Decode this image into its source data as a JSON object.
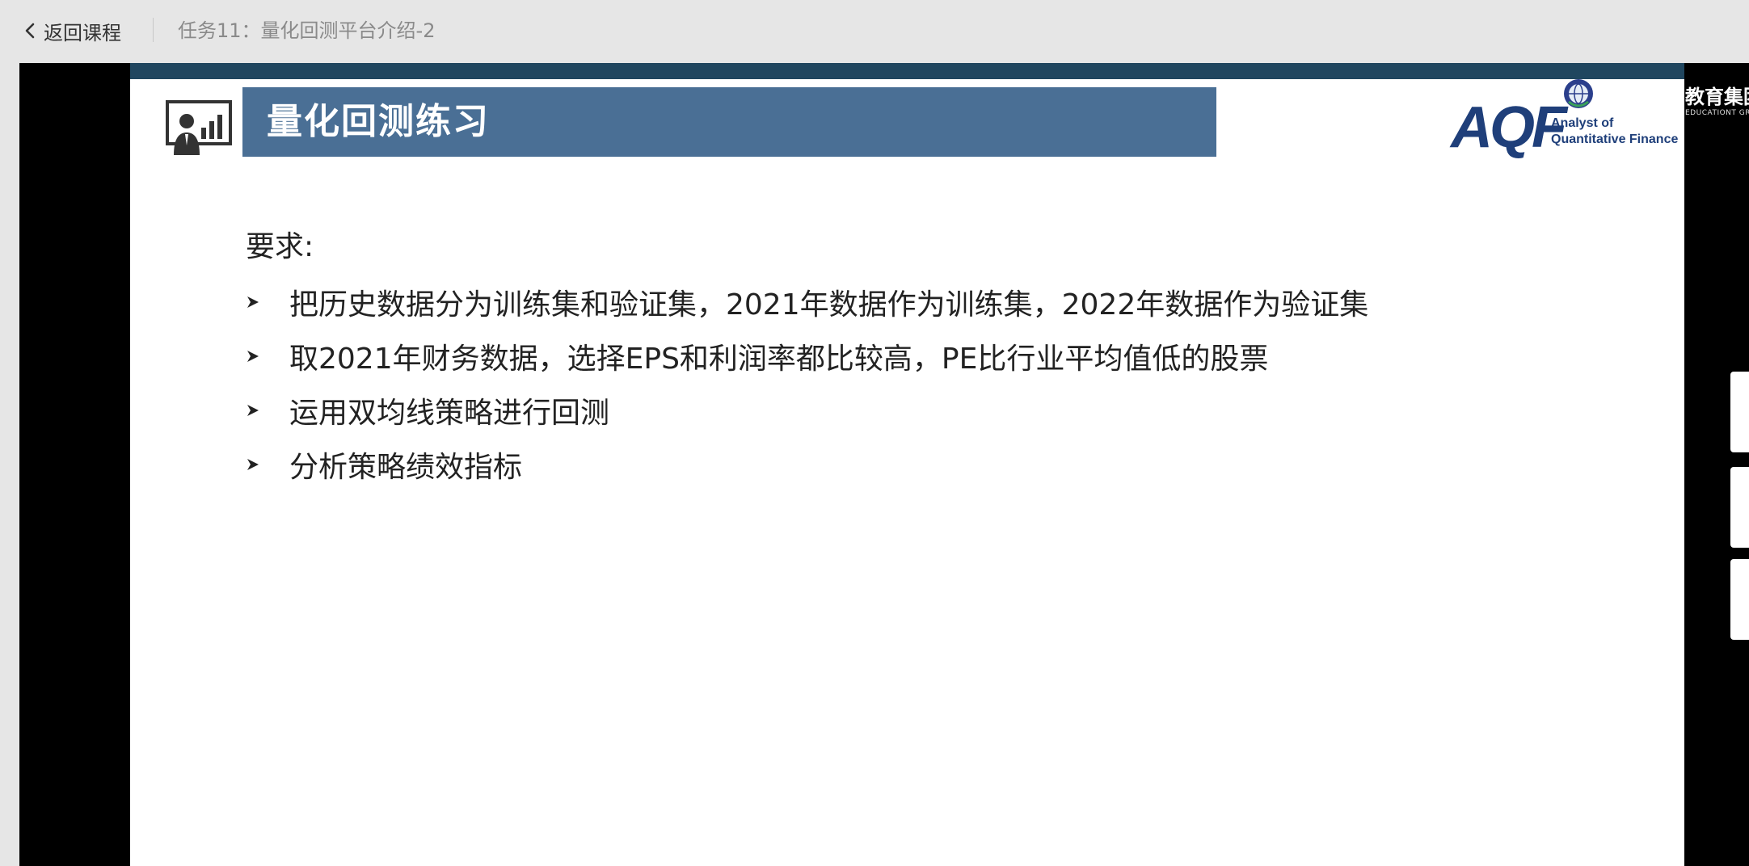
{
  "topbar": {
    "back_label": "返回课程",
    "task_title": "任务11：量化回测平台介绍-2"
  },
  "slide": {
    "title": "量化回测练习",
    "logo": {
      "mark": "AQF",
      "line1": "Analyst of",
      "line2": "Quantitative Finance"
    },
    "edge_text": {
      "cn": "教育集团",
      "en": "EDUCATIONT GROUP"
    },
    "requirements_label": "要求:",
    "bullets": [
      "把历史数据分为训练集和验证集，2021年数据作为训练集，2022年数据作为验证集",
      "取2021年财务数据，选择EPS和利润率都比较高，PE比行业平均值低的股票",
      "运用双均线策略进行回测",
      "分析策略绩效指标"
    ]
  },
  "colors": {
    "banner": "#4a6f95",
    "top_band": "#20465f",
    "logo_blue": "#1f3f7a"
  }
}
